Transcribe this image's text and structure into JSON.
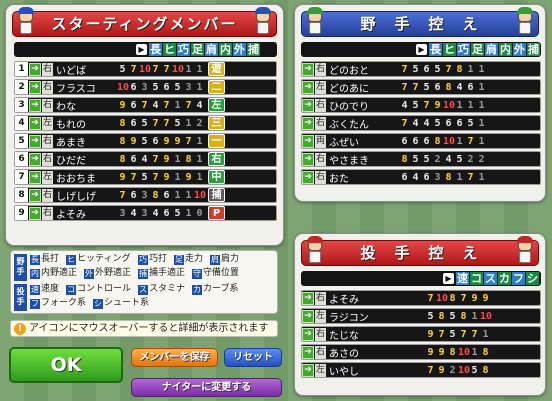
{
  "starting": {
    "title": "スターティングメンバー",
    "headers": [
      "長",
      "ヒ",
      "巧",
      "足",
      "肩",
      "内",
      "外",
      "捕"
    ],
    "rows": [
      {
        "num": "1",
        "bat": "右",
        "name": "いどば",
        "stats": [
          "5",
          "7",
          "10",
          "7",
          "7",
          "10",
          "1",
          "1"
        ],
        "pos": "遊"
      },
      {
        "num": "2",
        "bat": "右",
        "name": "フラスコ",
        "stats": [
          "10",
          "6",
          "3",
          "5",
          "6",
          "5",
          "3",
          "1"
        ],
        "pos": "二"
      },
      {
        "num": "3",
        "bat": "右",
        "name": "わな",
        "stats": [
          "9",
          "6",
          "7",
          "4",
          "7",
          "1",
          "7",
          "4"
        ],
        "pos": "左"
      },
      {
        "num": "4",
        "bat": "左",
        "name": "もれの",
        "stats": [
          "8",
          "6",
          "5",
          "7",
          "7",
          "5",
          "1",
          "2"
        ],
        "pos": "三"
      },
      {
        "num": "5",
        "bat": "右",
        "name": "あまき",
        "stats": [
          "8",
          "9",
          "5",
          "6",
          "9",
          "9",
          "7",
          "1"
        ],
        "pos": "一"
      },
      {
        "num": "6",
        "bat": "右",
        "name": "ひだだ",
        "stats": [
          "8",
          "6",
          "4",
          "7",
          "9",
          "1",
          "8",
          "1"
        ],
        "pos": "右"
      },
      {
        "num": "7",
        "bat": "左",
        "name": "おおちま",
        "stats": [
          "9",
          "7",
          "5",
          "7",
          "9",
          "1",
          "9",
          "1"
        ],
        "pos": "中"
      },
      {
        "num": "8",
        "bat": "右",
        "name": "しげしげ",
        "stats": [
          "7",
          "6",
          "3",
          "8",
          "6",
          "1",
          "1",
          "10"
        ],
        "pos": "捕"
      },
      {
        "num": "9",
        "bat": "右",
        "name": "よそみ",
        "stats": [
          "3",
          "4",
          "3",
          "4",
          "6",
          "5",
          "1",
          "0"
        ],
        "pos": "P"
      }
    ]
  },
  "bench": {
    "title": "野　手　控　え",
    "headers": [
      "長",
      "ヒ",
      "巧",
      "足",
      "肩",
      "内",
      "外",
      "捕"
    ],
    "rows": [
      {
        "bat": "右",
        "name": "どのおと",
        "stats": [
          "7",
          "5",
          "6",
          "5",
          "7",
          "8",
          "1",
          "1"
        ]
      },
      {
        "bat": "左",
        "name": "どのあに",
        "stats": [
          "7",
          "7",
          "5",
          "6",
          "8",
          "4",
          "6",
          "1"
        ]
      },
      {
        "bat": "右",
        "name": "ひのでり",
        "stats": [
          "4",
          "5",
          "7",
          "9",
          "10",
          "1",
          "1",
          "1"
        ]
      },
      {
        "bat": "右",
        "name": "ぶくたん",
        "stats": [
          "7",
          "4",
          "4",
          "5",
          "6",
          "6",
          "5",
          "1"
        ]
      },
      {
        "bat": "両",
        "name": "ふぜい",
        "stats": [
          "6",
          "6",
          "6",
          "8",
          "10",
          "1",
          "7",
          "1"
        ]
      },
      {
        "bat": "右",
        "name": "やさまき",
        "stats": [
          "8",
          "5",
          "5",
          "2",
          "4",
          "5",
          "2",
          "2"
        ]
      },
      {
        "bat": "右",
        "name": "おた",
        "stats": [
          "6",
          "4",
          "6",
          "3",
          "8",
          "1",
          "7",
          "1"
        ]
      }
    ]
  },
  "pitchers": {
    "title": "投　手　控　え",
    "headers": [
      "速",
      "コ",
      "ス",
      "カ",
      "フ",
      "シ"
    ],
    "rows": [
      {
        "bat": "右",
        "name": "よそみ",
        "stats": [
          "7",
          "10",
          "8",
          "7",
          "9",
          "9"
        ]
      },
      {
        "bat": "左",
        "name": "ラジコン",
        "stats": [
          "5",
          "8",
          "5",
          "8",
          "1",
          "10"
        ]
      },
      {
        "bat": "右",
        "name": "たじな",
        "stats": [
          "9",
          "7",
          "5",
          "7",
          "7",
          "1"
        ]
      },
      {
        "bat": "右",
        "name": "あさの",
        "stats": [
          "9",
          "9",
          "8",
          "10",
          "1",
          "8"
        ]
      },
      {
        "bat": "左",
        "name": "いやし",
        "stats": [
          "7",
          "9",
          "2",
          "10",
          "5",
          "8"
        ]
      }
    ]
  },
  "legend": {
    "fielder_label": "野手",
    "pitcher_label": "投手",
    "items": [
      {
        "k": "長",
        "t": "長打"
      },
      {
        "k": "ヒ",
        "t": "ヒッティング"
      },
      {
        "k": "巧",
        "t": "巧打"
      },
      {
        "k": "足",
        "t": "走力"
      },
      {
        "k": "肩",
        "t": "肩力"
      },
      {
        "k": "内",
        "t": "内野適正"
      },
      {
        "k": "外",
        "t": "外野適正"
      },
      {
        "k": "捕",
        "t": "捕手適正"
      },
      {
        "k": "守",
        "t": "守備位置"
      },
      {
        "k": "速",
        "t": "速度"
      },
      {
        "k": "コ",
        "t": "コントロール"
      },
      {
        "k": "ス",
        "t": "スタミナ"
      },
      {
        "k": "カ",
        "t": "カーブ系"
      },
      {
        "k": "フ",
        "t": "フォーク系"
      },
      {
        "k": "シ",
        "t": "シュート系"
      }
    ]
  },
  "note": "アイコンにマウスオーバーすると詳細が表示されます",
  "buttons": {
    "ok": "OK",
    "save": "メンバーを保存",
    "reset": "リセット",
    "night": "ナイターに変更する"
  },
  "colors": {
    "red_banner": "#c92121",
    "blue_banner": "#2f4cb0",
    "green_button": "#3fb52c",
    "orange_button": "#f08d1a",
    "blue_button": "#2f62d6",
    "purple_button": "#8d3bb5"
  },
  "icons": {
    "mascot": "player-chibi-icon",
    "batter": "batter-icon",
    "warning": "exclamation-icon",
    "arrow": "triangle-arrow-icon"
  }
}
